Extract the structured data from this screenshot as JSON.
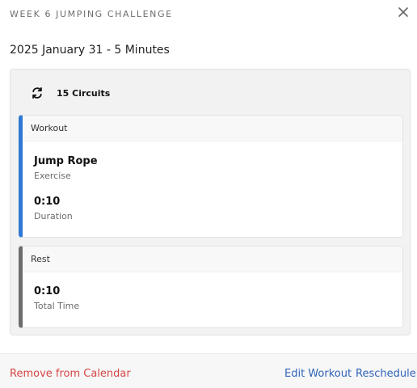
{
  "modal": {
    "title": "WEEK 6 JUMPING CHALLENGE",
    "subtitle": "2025 January 31 - 5 Minutes",
    "close_icon": "close-icon"
  },
  "circuit": {
    "icon": "refresh-icon",
    "count_label": "15 Circuits"
  },
  "workout_card": {
    "header": "Workout",
    "accent": "#2f78d4",
    "exercise_value": "Jump Rope",
    "exercise_label": "Exercise",
    "duration_value": "0:10",
    "duration_label": "Duration"
  },
  "rest_card": {
    "header": "Rest",
    "accent": "#6d6d6d",
    "time_value": "0:10",
    "time_label": "Total Time"
  },
  "footer": {
    "remove_label": "Remove from Calendar",
    "edit_label": "Edit Workout",
    "reschedule_label": "Reschedule"
  },
  "colors": {
    "danger": "#d64545",
    "link": "#2f63b8",
    "panel_bg": "#f2f2f2"
  }
}
